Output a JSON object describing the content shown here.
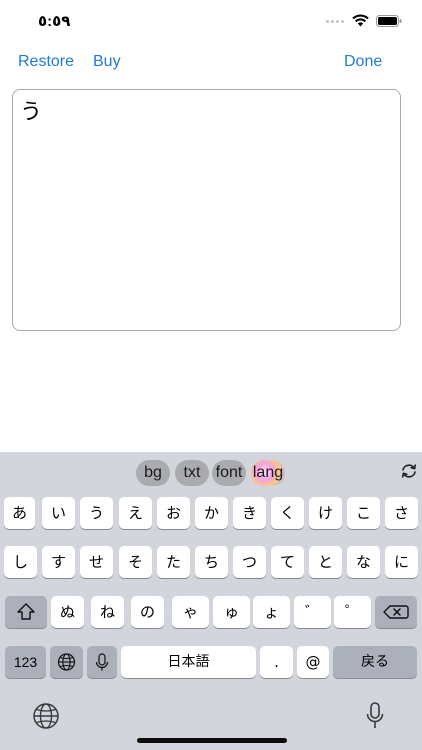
{
  "status_bar": {
    "time": "٥:٥٩"
  },
  "nav": {
    "restore": "Restore",
    "buy": "Buy",
    "done": "Done"
  },
  "editor": {
    "text": "う"
  },
  "toolbar": {
    "bg": "bg",
    "txt": "txt",
    "font": "font",
    "lang": "lang"
  },
  "keyboard": {
    "row1": [
      "あ",
      "い",
      "う",
      "え",
      "お",
      "か",
      "き",
      "く",
      "け",
      "こ",
      "さ"
    ],
    "row2": [
      "し",
      "す",
      "せ",
      "そ",
      "た",
      "ち",
      "つ",
      "て",
      "と",
      "な",
      "に"
    ],
    "row3": [
      "ぬ",
      "ね",
      "の",
      "ゃ",
      "ゅ",
      "ょ",
      "゛",
      "゜"
    ],
    "mode_key": "123",
    "space": "日本語",
    "period": ".",
    "at": "@",
    "return": "戻る"
  },
  "colors": {
    "accent": "#1f7bd6",
    "keyboard_bg": "#d2d5db",
    "key_gray": "#abb0ba"
  }
}
